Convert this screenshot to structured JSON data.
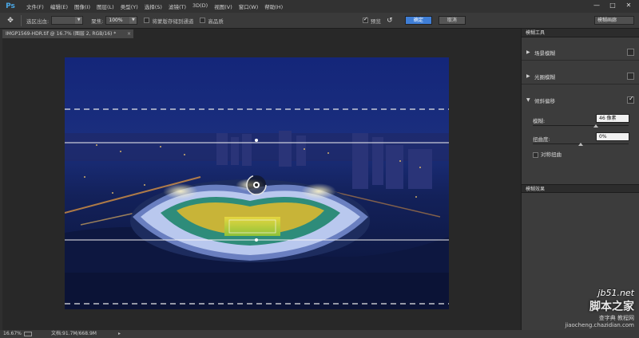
{
  "app": {
    "logo": "Ps"
  },
  "menu": [
    "文件(F)",
    "编辑(E)",
    "图像(I)",
    "图层(L)",
    "类型(Y)",
    "选择(S)",
    "滤镜(T)",
    "3D(D)",
    "视图(V)",
    "窗口(W)",
    "帮助(H)"
  ],
  "window_controls": {
    "minimize": "—",
    "maximize": "□",
    "close": "✕"
  },
  "options": {
    "tool_icon": "pin-icon",
    "selection_bleed_label": "选区出血:",
    "selection_bleed_value": "",
    "focus_label": "聚焦:",
    "focus_value": "100%",
    "save_mask_label": "将蒙版存储到通道",
    "high_quality_label": "高品质",
    "preview_label": "预览",
    "ok_label": "确定",
    "cancel_label": "取消",
    "workspace_value": "模糊画廊"
  },
  "document": {
    "tab_title": "IMGP1569-HDR.tif @ 16.7% (图层 2, RGB/16) *",
    "close": "×"
  },
  "status": {
    "zoom": "16.67%",
    "doc_size": "文档:91.7M/668.9M",
    "arrow": "▸"
  },
  "panel": {
    "title": "模糊工具",
    "items": [
      {
        "label": "场景模糊",
        "expanded": false,
        "checked": false
      },
      {
        "label": "光圈模糊",
        "expanded": false,
        "checked": false
      },
      {
        "label": "倾斜偏移",
        "expanded": true,
        "checked": true
      }
    ],
    "blur_label": "模糊:",
    "blur_value": "46 像素",
    "blur_slider": 0.66,
    "distortion_label": "扭曲度:",
    "distortion_value": "0%",
    "distortion_slider": 0.5,
    "symmetric_label": "对称扭曲",
    "effects_title": "模糊效果"
  },
  "watermark": {
    "site": "jb51.net",
    "title": "脚本之家",
    "sub": "查字典 教程网",
    "url": "jiaocheng.chazidian.com"
  },
  "colors": {
    "accent": "#3f7ed6",
    "canvas_bg": "#282828",
    "panel_bg": "#3c3c3c"
  }
}
